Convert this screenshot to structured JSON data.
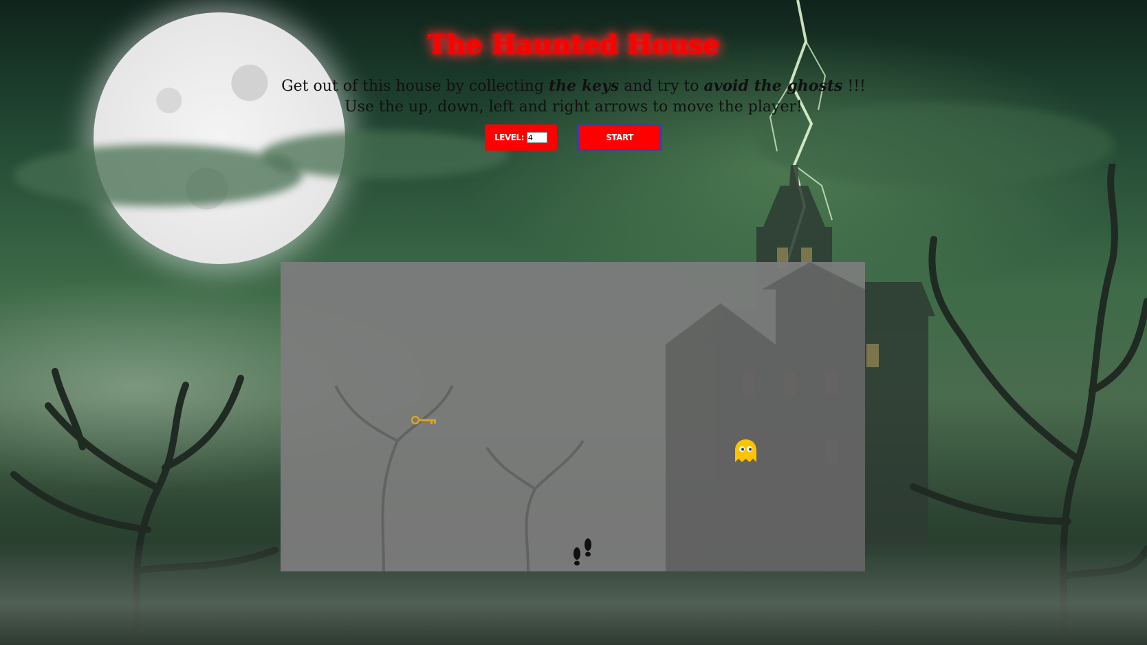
{
  "page": {
    "title": "The Haunted House"
  },
  "instructions": {
    "line1_prefix": "Get out of this house by collecting ",
    "line1_keys": "the keys",
    "line1_middle": " and try to ",
    "line1_ghosts": "avoid the ghosts",
    "line1_suffix": " !!!",
    "line2": "Use the up, down, left and right arrows to move the player!"
  },
  "controls": {
    "level_label": "LEVEL:",
    "level_value": "4",
    "start_label": "START"
  },
  "board": {
    "sprites": [
      {
        "name": "key-icon",
        "kind": "key"
      },
      {
        "name": "ghost-icon",
        "kind": "ghost"
      },
      {
        "name": "player-footprints-icon",
        "kind": "player"
      }
    ]
  },
  "colors": {
    "title_red": "#ff0000",
    "button_red": "#ff0000",
    "ghost_yellow": "#ffc400",
    "key_gold": "#d9a521"
  }
}
